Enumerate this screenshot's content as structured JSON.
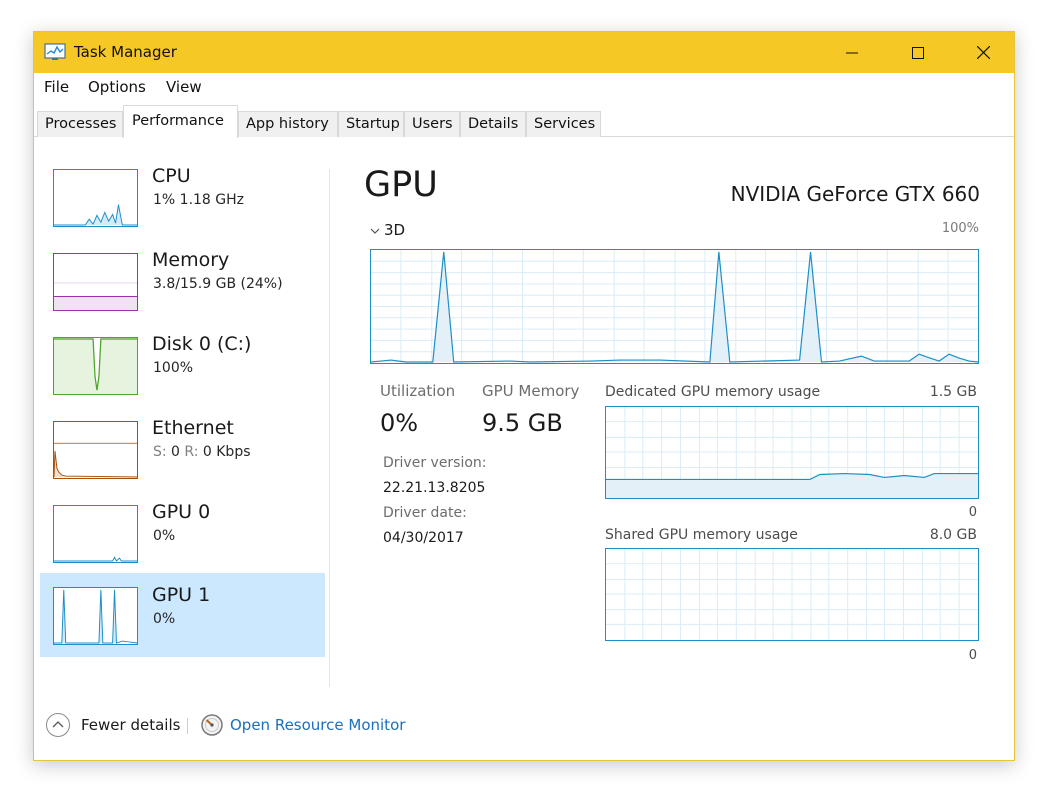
{
  "window": {
    "title": "Task Manager",
    "accent_color": "#f5c826",
    "controls": {
      "minimize_icon": "minimize-icon",
      "maximize_icon": "maximize-icon",
      "close_icon": "close-icon"
    }
  },
  "menu": [
    "File",
    "Options",
    "View"
  ],
  "tabs": [
    {
      "label": "Processes",
      "active": false
    },
    {
      "label": "Performance",
      "active": true
    },
    {
      "label": "App history",
      "active": false
    },
    {
      "label": "Startup",
      "active": false
    },
    {
      "label": "Users",
      "active": false
    },
    {
      "label": "Details",
      "active": false
    },
    {
      "label": "Services",
      "active": false
    }
  ],
  "sidebar": {
    "items": [
      {
        "name": "CPU",
        "sub": "1%  1.18 GHz",
        "color": "#1c8fc9",
        "selected": false
      },
      {
        "name": "Memory",
        "sub": "3.8/15.9 GB (24%)",
        "color": "#9b2fae",
        "selected": false
      },
      {
        "name": "Disk 0 (C:)",
        "sub": "100%",
        "color": "#4da52b",
        "selected": false
      },
      {
        "name": "Ethernet",
        "sub_prefix_s": "S:",
        "sub_value_s": " 0 ",
        "sub_prefix_r": "R:",
        "sub_value_r": " 0 Kbps",
        "color": "#a84f0b",
        "selected": false
      },
      {
        "name": "GPU 0",
        "sub": "0%",
        "color": "#1c8fc9",
        "selected": false
      },
      {
        "name": "GPU 1",
        "sub": "0%",
        "color": "#1c8fc9",
        "selected": true
      }
    ]
  },
  "main": {
    "title": "GPU",
    "device_name": "NVIDIA GeForce GTX 660",
    "engine_label": "3D",
    "engine_max": "100%",
    "stats": {
      "utilization_label": "Utilization",
      "utilization_value": "0%",
      "gpu_memory_label": "GPU Memory",
      "gpu_memory_value": "9.5 GB"
    },
    "info": {
      "driver_version_label": "Driver version:",
      "driver_version_value": "22.21.13.8205",
      "driver_date_label": "Driver date:",
      "driver_date_value": "04/30/2017"
    },
    "dedicated": {
      "label": "Dedicated GPU memory usage",
      "max": "1.5 GB",
      "min": "0"
    },
    "shared": {
      "label": "Shared GPU memory usage",
      "max": "8.0 GB",
      "min": "0"
    }
  },
  "footer": {
    "fewer_details": "Fewer details",
    "open_resource_monitor": "Open Resource Monitor",
    "link_color": "#1a6fbf"
  }
}
